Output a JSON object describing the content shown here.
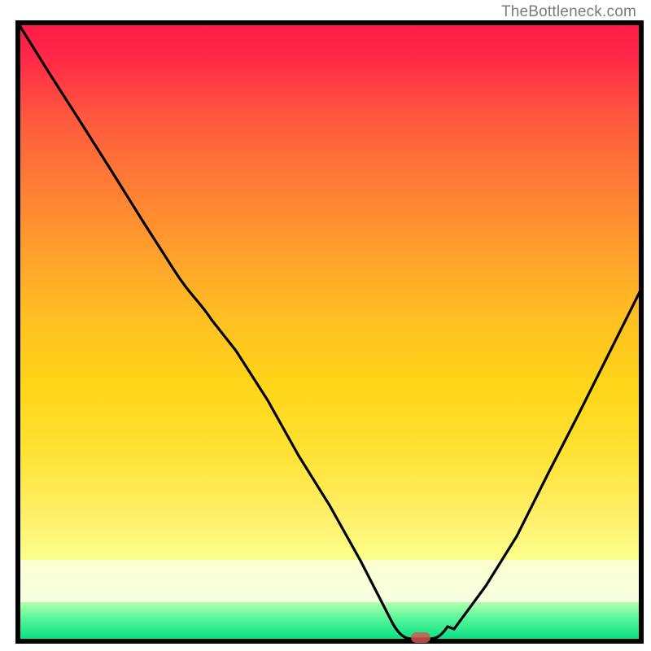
{
  "attribution": "TheBottleneck.com",
  "chart_data": {
    "type": "line",
    "title": "",
    "xlabel": "",
    "ylabel": "",
    "x": [
      0.0,
      0.05,
      0.1,
      0.15,
      0.2,
      0.25,
      0.3,
      0.35,
      0.4,
      0.45,
      0.5,
      0.55,
      0.6,
      0.63,
      0.66,
      0.7,
      0.75,
      0.8,
      0.85,
      0.9,
      0.95,
      1.0
    ],
    "y": [
      1.0,
      0.92,
      0.84,
      0.76,
      0.68,
      0.6,
      0.55,
      0.47,
      0.39,
      0.3,
      0.22,
      0.13,
      0.03,
      0.0,
      0.0,
      0.02,
      0.09,
      0.17,
      0.27,
      0.37,
      0.47,
      0.57
    ],
    "xlim": [
      0,
      1
    ],
    "ylim": [
      0,
      1
    ],
    "minimum_marker": {
      "x": 0.645,
      "y": 0.0
    },
    "background_gradient": {
      "top_color": "#ff1744",
      "mid_color": "#ffd400",
      "low_color": "#f7ff6e",
      "bottom_color": "#00e676"
    }
  }
}
